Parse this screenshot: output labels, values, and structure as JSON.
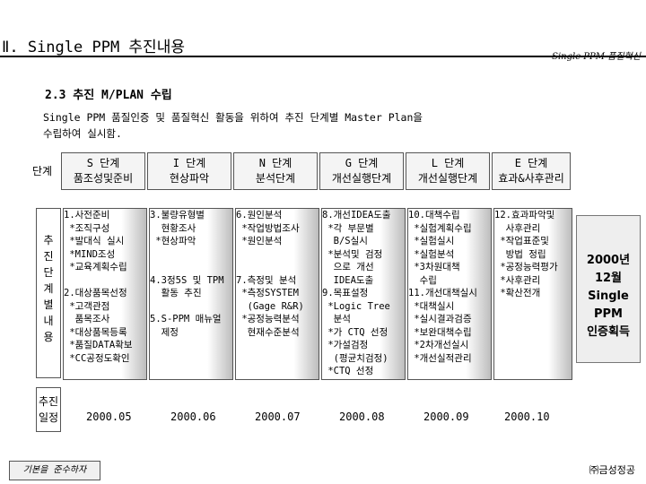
{
  "header": {
    "title": "Ⅱ. Single PPM 추진내용",
    "brand": "Single PPM 품질혁신"
  },
  "section": {
    "subtitle": "2.3 추진 M/PLAN 수립",
    "intro": "Single PPM 품질인증 및 품질혁신 활동을 위하여 추진 단계별 Master Plan을\n수립하여 실시함."
  },
  "stage_row_label": "단계",
  "stages": [
    {
      "letter": "S 단계",
      "name": "품조성및준비"
    },
    {
      "letter": "I 단계",
      "name": "현상파악"
    },
    {
      "letter": "N 단계",
      "name": "분석단계"
    },
    {
      "letter": "G 단계",
      "name": "개선실행단계"
    },
    {
      "letter": "L 단계",
      "name": "개선실행단계"
    },
    {
      "letter": "E 단계",
      "name": "효과&사후관리"
    }
  ],
  "content_row_label": "추\n진\n단\n계\n별\n내\n용",
  "columns": [
    "1.사전준비\n *조직구성\n *발대식 실시\n *MIND조성\n *교육계획수립\n\n2.대상품목선정\n *고객관점\n  품목조사\n *대상품목등록\n *품질DATA확보\n *CC공정도확인",
    "3.불량유형별\n  현황조사\n *현상파악\n\n\n4.3정5S 및 TPM\n  활동 추진\n\n5.S-PPM 매뉴얼\n  제정",
    "6.원인분석\n *작업방법조사\n *원인분석\n\n\n7.측정및 분석\n *측정SYSTEM\n  (Gage R&R)\n *공정능력분석\n  현재수준분석",
    "8.개선IDEA도출\n *각 부문별\n  B/S실시\n *분석및 검정\n  으로 개선\n  IDEA도출\n9.목표설정\n *Logic Tree\n  분석\n *가 CTQ 선정\n *가설검정\n  (평균치검정)\n *CTQ 선정",
    "10.대책수립\n *실험계획수립\n *실험실시\n *실험분석\n *3차원대책\n  수립\n11.개선대책실시\n *대책실시\n *실시결과검증\n *보완대책수립\n *2차개선실시\n *개선실적관리",
    "12.효과파악및\n  사후관리\n *작업표준및\n  방법 정립\n *공정능력평가\n *사후관리\n *확산전개"
  ],
  "date_row_label": "추진\n일정",
  "dates": [
    "2000.05",
    "2000.06",
    "2000.07",
    "2000.08",
    "2000.09",
    "2000.10"
  ],
  "callout": "2000년\n12월\nSingle\nPPM\n인증획득",
  "footer": {
    "motto": "기본을 준수하자",
    "company": "㈜금성정공"
  }
}
